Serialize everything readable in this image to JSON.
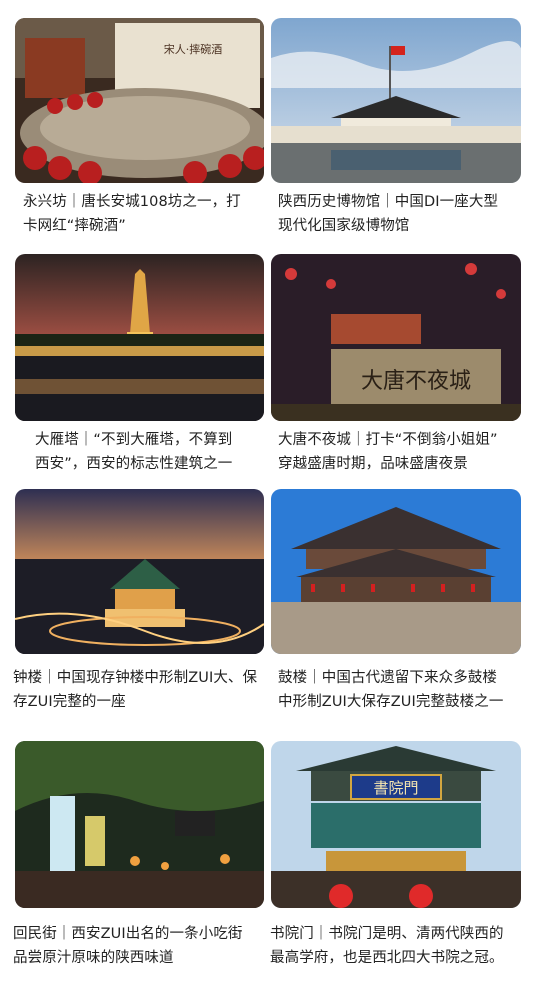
{
  "attractions": [
    {
      "id": "yongxingfang",
      "icon": "wine-jars-photo",
      "lines": [
        "永兴坊｜唐长安城108坊之一，打",
        "卡网红“摔碗酒”"
      ]
    },
    {
      "id": "shaanxi-history-museum",
      "icon": "museum-photo",
      "lines": [
        "陕西历史博物馆｜中国DI一座大型",
        "现代化国家级博物馆"
      ]
    },
    {
      "id": "big-wild-goose-pagoda",
      "icon": "pagoda-photo",
      "lines": [
        "大雁塔｜“不到大雁塔，不算到",
        "西安”，西安的标志性建筑之一"
      ]
    },
    {
      "id": "datang-everbright-city",
      "icon": "stone-inscription-photo",
      "lines": [
        "大唐不夜城｜打卡“不倒翁小姐姐”",
        "穿越盛唐时期，品味盛唐夜景"
      ]
    },
    {
      "id": "bell-tower",
      "icon": "bell-tower-photo",
      "lines": [
        "钟楼｜中国现存钟楼中形制ZUI大、保",
        "存ZUI完整的一座"
      ]
    },
    {
      "id": "drum-tower",
      "icon": "drum-tower-photo",
      "lines": [
        "鼓楼｜中国古代遗留下来众多鼓楼",
        "中形制ZUI大保存ZUI完整鼓楼之一"
      ]
    },
    {
      "id": "huimin-street",
      "icon": "street-photo",
      "lines": [
        "回民街｜西安ZUI出名的一条小吃街",
        "品尝原汁原味的陕西味道"
      ]
    },
    {
      "id": "shuyuanmen",
      "icon": "archway-photo",
      "lines": [
        "书院门｜书院门是明、清两代陕西的",
        "最高学府，也是西北四大书院之冠。"
      ]
    }
  ],
  "photo_text": {
    "datang_inscription": "大唐不夜城",
    "shuyuanmen_plaque": "書院門",
    "yongxing_sign": "宋人·摔碗酒"
  }
}
